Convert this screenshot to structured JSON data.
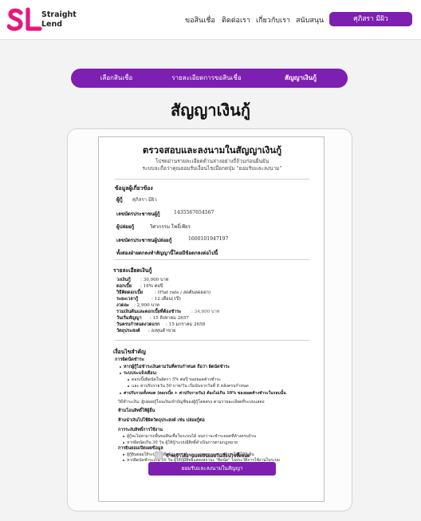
{
  "brand": {
    "line1": "Straight",
    "line2": "Lend",
    "logo_color": "#e5177e"
  },
  "nav": {
    "loan": "ขอสินเชื่อ",
    "contact": "ติดต่อเรา",
    "about": "เกี่ยวกับเรา",
    "support": "สนับสนุน"
  },
  "user": {
    "name": "ศุภิสรา มีผิว"
  },
  "steps": [
    {
      "label": "เลือกสินเชื่อ"
    },
    {
      "label": "รายละเอียดการขอสินเชื่อ"
    },
    {
      "label": "สัญญาเงินกู้"
    }
  ],
  "page_title": "สัญญาเงินกู้",
  "doc": {
    "title": "ตรวจสอบและลงนามในสัญญาเงินกู้",
    "intro_1": "โปรดอ่านรายละเอียดด้านล่างอย่างถี่ถ้วนก่อนยืนยัน",
    "intro_2": "ระบบจะถือว่าคุณยอมรับเงื่อนไขเมื่อกดปุ่ม \"ยอมรับและลงนาม\"",
    "parties_heading": "ข้อมูลผู้เกี่ยวข้อง",
    "borrower_label": "ผู้กู้",
    "borrower_name": "ศุภิสรา มีผิว",
    "borrower_id_label": "เลขบัตรประชาชนผู้กู้",
    "borrower_id": "1435567654567",
    "lender_label": "ผู้ปล่อยกู้",
    "lender_name": "วิศวกรรม โพธิ์เพียร",
    "lender_id_label": "เลขบัตรประชาชนผู้ปล่อยกู้",
    "lender_id": "1600101947197",
    "agree_line": "ทั้งสองฝ่ายตกลงทำสัญญานี้โดยมีข้อตกลงต่อไปนี้",
    "details_heading": "รายละเอียดเงินกู้",
    "amount_label": "วงเงินกู้",
    "amount_value": ": 30,000 บาท",
    "interest_label": "ดอกเบี้ย",
    "interest_value": ": 16% ต่อปี",
    "method_label": "วิธีคิดดอกเบี้ย",
    "method_value": ": (Flat rate / ลดต้นลดดอก)",
    "term_label": "ระยะเวลากู้",
    "term_value": ": 12 เดือน(1ปี)",
    "installment_label": "งวดละ",
    "installment_value": ": 2,900 บาท",
    "total_label": "รวมเงินต้นและดอกเบี้ยที่ต้องชำระ",
    "total_value": ": 34,800 บาท",
    "start_label": "วันเริ่มสัญญา",
    "start_value": ": 15 สิงหาคม 2657",
    "due_label": "วันครบกำหนดงวดแรก",
    "due_value": ": 15 มกราคม 2658",
    "purpose_label": "วัตถุประสงค์",
    "purpose_value": ": ลงทุนค้าขาย",
    "terms_heading": "เงื่อนไขสำคัญ",
    "late_heading": "การผิดนัดชำระ",
    "late_1": "หากผู้กู้ไม่ชำระเงินตามวันที่ครบกำหนด ถือว่า ผิดนัดชำระ",
    "late_2": "ระบบจะแจ้งเตือน:",
    "late_2a": "ดอกเบี้ยผิดนัดในอัตรา 5% ต่อปี ของยอดค้างชำระ",
    "late_2b": "และ ค่าปรับรายวัน 50 บาท/วัน เริ่มนับจากวันที่ 8 หลังครบกำหนด",
    "late_3": "ค่าปรับรวมทั้งหมด (ดอกเบี้ย + ค่าปรับรายวัน) ต้องไม่เกิน 10% ของยอดค้างชำระในรอบนั้น",
    "pay_line": "วิธีชำระเงิน: ผู้ปล่อยกู้โอนเงินเข้าบัญชีของผู้กู้โดยตรง ตามรายละเอียดที่ระบบแสดง",
    "ban_1": "ห้ามโอนสิทธิ์ให้ผู้อื่น",
    "ban_2": "ห้ามนำเงินไปใช้ผิดวัตถุประสงค์ เช่น ปล่อยกู้ต่อ",
    "cancel_heading": "การระงับสิทธิ์การใช้งาน",
    "cancel_1": "ผู้กู้จะไม่สามารถยื่นขอสินเชื่อในระบบได้ จนกว่าจะชำระยอดที่ค้างครบถ้วน",
    "cancel_2": "หากผิดนัดเกิน 30 วัน ผู้ให้กู้/ระบบมีสิทธิ์ดำเนินการตามกฎหมาย",
    "privacy_heading": "การยินยอมเปิดเผยข้อมูล",
    "privacy_1": "ผู้กู้ยินยอมให้ระบบบันทึกข้อมูลการกู้ และแสดงสถานะการชำระให้ผู้ให้กู้เห็น",
    "privacy_2": "หากผิดนัดชำระเกิน 30 วัน ผู้ให้กู้มีสิทธิ์แสดงสถานะ \"ผิดนัด\" ในประวัติการใช้งานในระบบ",
    "checkbox_label": "ข้าพเจ้าได้อ่านและยินยอมในเงื่อนไขทั้งหมด",
    "sign_button": "ยอมรับและลงนามในสัญญา"
  }
}
